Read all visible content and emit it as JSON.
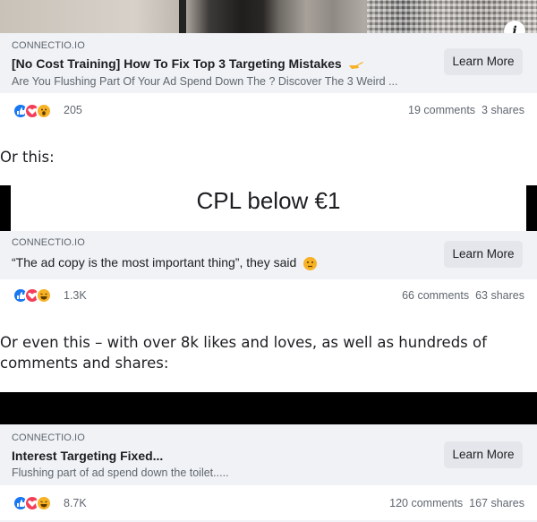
{
  "ad1": {
    "domain": "CONNECTIO.IO",
    "headline": "[No Cost Training] How To Fix Top 3 Targeting Mistakes",
    "headline_emoji": "pointing-hand-icon",
    "description": "Are You Flushing Part Of Your Ad Spend Down The ? Discover The 3 Weird ...",
    "cta": "Learn More",
    "reaction_count": "205",
    "comments": "19 comments",
    "shares": "3 shares",
    "reactions": [
      "like-icon",
      "love-icon",
      "wow-icon"
    ]
  },
  "prose1": "Or this:",
  "ad2": {
    "image_text": "CPL below €1",
    "domain": "CONNECTIO.IO",
    "headline": "“The ad copy is the most important thing”, they said",
    "headline_emoji": "thinking-face-icon",
    "cta": "Learn More",
    "reaction_count": "1.3K",
    "comments": "66 comments",
    "shares": "63 shares",
    "reactions": [
      "like-icon",
      "love-icon",
      "haha-icon"
    ]
  },
  "prose2": "Or even this – with over 8k likes and loves, as well as hundreds of comments and shares:",
  "ad3": {
    "domain": "CONNECTIO.IO",
    "headline": "Interest Targeting Fixed...",
    "description": "Flushing part of ad spend down the toilet.....",
    "cta": "Learn More",
    "reaction_count": "8.7K",
    "comments": "120 comments",
    "shares": "167 shares",
    "reactions": [
      "like-icon",
      "love-icon",
      "haha-icon"
    ]
  },
  "colors": {
    "like": "#1877f2",
    "love": "#f33e58",
    "wow": "#f7b125",
    "adbar": "#f0f2f5",
    "button": "#e4e6eb"
  }
}
